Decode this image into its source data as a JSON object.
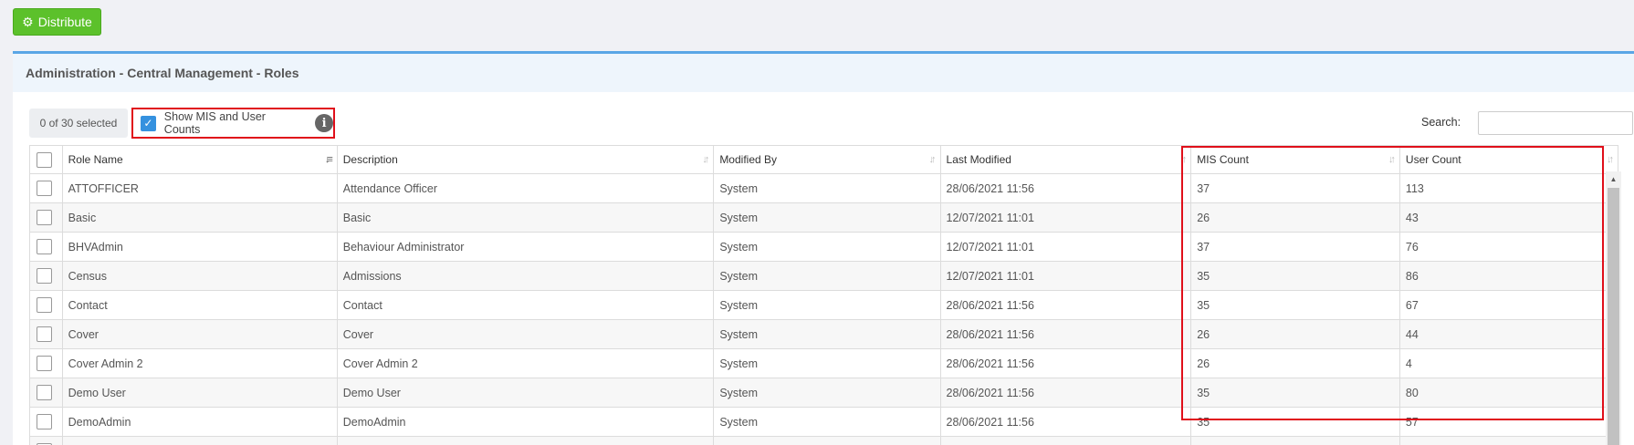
{
  "toolbar": {
    "distribute_label": "Distribute"
  },
  "panel": {
    "title": "Administration - Central Management - Roles"
  },
  "selection": {
    "count_text": "0 of 30 selected"
  },
  "toggle": {
    "label": "Show MIS and User Counts",
    "checked": true
  },
  "search": {
    "label": "Search:",
    "value": ""
  },
  "table": {
    "headers": [
      "Role Name",
      "Description",
      "Modified By",
      "Last Modified",
      "MIS Count",
      "User Count"
    ],
    "sorted_column": "Role Name",
    "rows": [
      [
        "ATTOFFICER",
        "Attendance Officer",
        "System",
        "28/06/2021 11:56",
        "37",
        "113"
      ],
      [
        "Basic",
        "Basic",
        "System",
        "12/07/2021 11:01",
        "26",
        "43"
      ],
      [
        "BHVAdmin",
        "Behaviour Administrator",
        "System",
        "12/07/2021 11:01",
        "37",
        "76"
      ],
      [
        "Census",
        "Admissions",
        "System",
        "12/07/2021 11:01",
        "35",
        "86"
      ],
      [
        "Contact",
        "Contact",
        "System",
        "28/06/2021 11:56",
        "35",
        "67"
      ],
      [
        "Cover",
        "Cover",
        "System",
        "28/06/2021 11:56",
        "26",
        "44"
      ],
      [
        "Cover Admin 2",
        "Cover Admin 2",
        "System",
        "28/06/2021 11:56",
        "26",
        "4"
      ],
      [
        "Demo User",
        "Demo User",
        "System",
        "28/06/2021 11:56",
        "35",
        "80"
      ],
      [
        "DemoAdmin",
        "DemoAdmin",
        "System",
        "28/06/2021 11:56",
        "35",
        "57"
      ],
      [
        "",
        "",
        "",
        "",
        "",
        ""
      ]
    ]
  },
  "colors": {
    "accent_green": "#5cc12b",
    "accent_blue": "#3591df",
    "highlight_red": "#e00f1a"
  },
  "icons": {
    "distribute": "gear-icon",
    "info": "info-icon",
    "sort": "sort-icon"
  }
}
